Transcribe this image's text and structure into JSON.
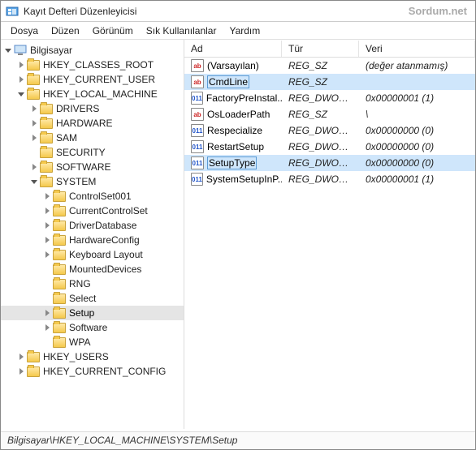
{
  "window": {
    "title": "Kayıt Defteri Düzenleyicisi",
    "watermark": "Sordum.net"
  },
  "menu": {
    "file": "Dosya",
    "edit": "Düzen",
    "view": "Görünüm",
    "fav": "Sık Kullanılanlar",
    "help": "Yardım"
  },
  "tree": {
    "root": "Bilgisayar",
    "hkcr": "HKEY_CLASSES_ROOT",
    "hkcu": "HKEY_CURRENT_USER",
    "hklm": "HKEY_LOCAL_MACHINE",
    "drivers": "DRIVERS",
    "hardware": "HARDWARE",
    "sam": "SAM",
    "security": "SECURITY",
    "software": "SOFTWARE",
    "system": "SYSTEM",
    "cs001": "ControlSet001",
    "ccs": "CurrentControlSet",
    "ddb": "DriverDatabase",
    "hwcfg": "HardwareConfig",
    "kbl": "Keyboard Layout",
    "md": "MountedDevices",
    "rng": "RNG",
    "select": "Select",
    "setup": "Setup",
    "sw": "Software",
    "wpa": "WPA",
    "hku": "HKEY_USERS",
    "hkcc": "HKEY_CURRENT_CONFIG"
  },
  "list": {
    "headers": {
      "name": "Ad",
      "type": "Tür",
      "data": "Veri"
    },
    "rows": [
      {
        "name": "(Varsayılan)",
        "type": "REG_SZ",
        "data": "(değer atanmamış)",
        "icon": "sz",
        "hl": false,
        "dot": false
      },
      {
        "name": "CmdLine",
        "type": "REG_SZ",
        "data": "",
        "icon": "sz",
        "hl": true,
        "dot": true,
        "boxed": true
      },
      {
        "name": "FactoryPreInstal...",
        "type": "REG_DWORD",
        "data": "0x00000001 (1)",
        "icon": "dw",
        "hl": false,
        "dot": false
      },
      {
        "name": "OsLoaderPath",
        "type": "REG_SZ",
        "data": "\\",
        "icon": "sz",
        "hl": false,
        "dot": false
      },
      {
        "name": "Respecialize",
        "type": "REG_DWORD",
        "data": "0x00000000 (0)",
        "icon": "dw",
        "hl": false,
        "dot": false
      },
      {
        "name": "RestartSetup",
        "type": "REG_DWORD",
        "data": "0x00000000 (0)",
        "icon": "dw",
        "hl": false,
        "dot": false
      },
      {
        "name": "SetupType",
        "type": "REG_DWORD",
        "data": "0x00000000 (0)",
        "icon": "dw",
        "hl": true,
        "dot": true,
        "boxed": true
      },
      {
        "name": "SystemSetupInP...",
        "type": "REG_DWORD",
        "data": "0x00000001 (1)",
        "icon": "dw",
        "hl": false,
        "dot": false
      }
    ]
  },
  "status": {
    "path": "Bilgisayar\\HKEY_LOCAL_MACHINE\\SYSTEM\\Setup"
  }
}
